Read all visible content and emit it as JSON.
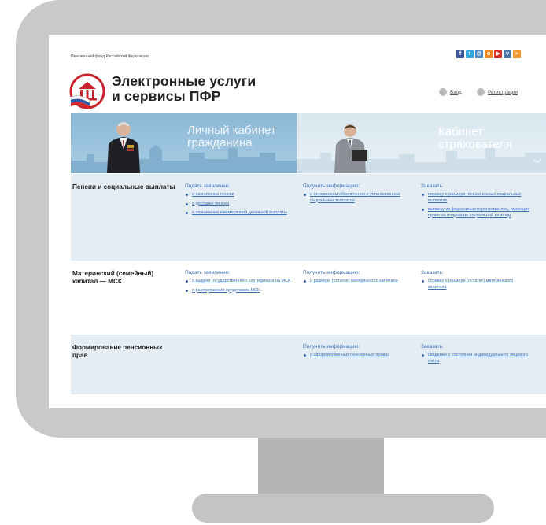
{
  "site": {
    "org": "Пенсионный фонд Российской Федерации",
    "title_line1": "Электронные услуги",
    "title_line2": "и сервисы ПФР",
    "login": "Вход",
    "register": "Регистрация"
  },
  "social_icons": [
    "facebook-icon",
    "twitter-icon",
    "email-icon",
    "odnoklassniki-icon",
    "youtube-icon",
    "vk-icon",
    "rss-icon"
  ],
  "colors": {
    "accent": "#3b6fb4",
    "section_bg": "#e4edf4",
    "monitor": "#c9c9c9"
  },
  "banners": {
    "citizen": {
      "line1": "Личный кабинет",
      "line2": "гражданина"
    },
    "insurer": {
      "line1": "Кабинет",
      "line2": "страхователя"
    }
  },
  "sections": [
    {
      "title": "Пенсии и социальные выплаты",
      "apply": {
        "heading": "Подать заявление:",
        "items": [
          "о назначении пенсии",
          "о доставке пенсии",
          "о назначении ежемесячной денежной выплаты"
        ]
      },
      "info": {
        "heading": "Получить информацию:",
        "items": [
          "о пенсионном обеспечении и установленных социальных выплатах"
        ]
      },
      "order": {
        "heading": "Заказать:",
        "items": [
          "справку о размере пенсии и иных социальных выплатах",
          "выписку из федерального регистра лиц, имеющих право на получение социальной помощи"
        ]
      }
    },
    {
      "title": "Материнский (семейный) капитал — МСК",
      "apply": {
        "heading": "Подать заявление:",
        "items": [
          "о выдаче государственного сертификата на МСК",
          "о распоряжении средствами МСК"
        ]
      },
      "info": {
        "heading": "Получить информацию:",
        "items": [
          "о размере (остатке) материнского капитала"
        ]
      },
      "order": {
        "heading": "Заказать:",
        "items": [
          "справку о размере (остатке) материнского капитала"
        ]
      }
    },
    {
      "title": "Формирование пенсионных прав",
      "info": {
        "heading": "Получить информацию:",
        "items": [
          "о сформированных пенсионных правах"
        ]
      },
      "order": {
        "heading": "Заказать:",
        "items": [
          "сведения о состоянии индивидуального лицевого счёта"
        ]
      }
    }
  ]
}
